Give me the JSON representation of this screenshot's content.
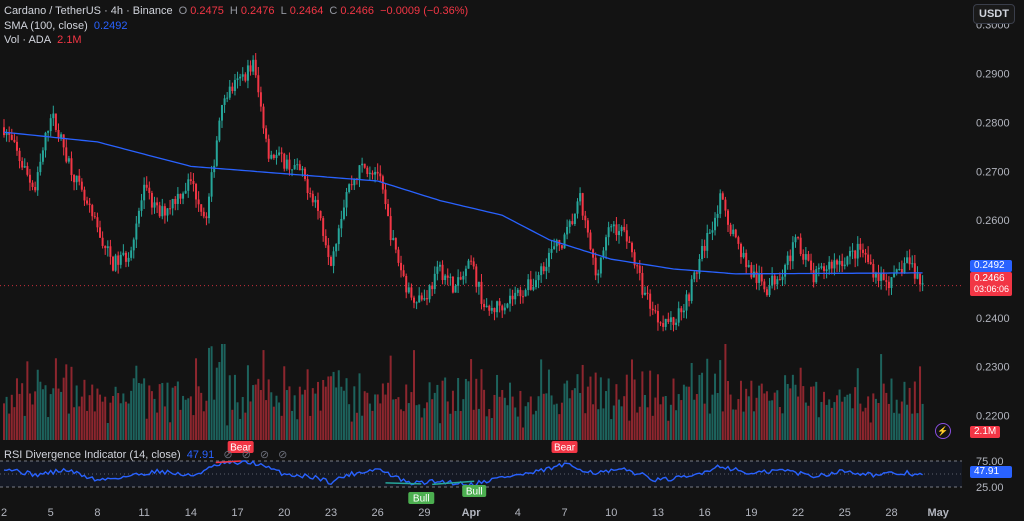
{
  "header": {
    "symbol": "Cardano / TetherUS · 4h · Binance",
    "o_key": "O",
    "o_val": "0.2475",
    "h_key": "H",
    "h_val": "0.2476",
    "l_key": "L",
    "l_val": "0.2464",
    "c_key": "C",
    "c_val": "0.2466",
    "change": "−0.0009 (−0.36%)"
  },
  "sma_legend": {
    "label": "SMA (100, close)",
    "value": "0.2492"
  },
  "vol_legend": {
    "label": "Vol · ADA",
    "value": "2.1M"
  },
  "rsi_legend": {
    "label": "RSI Divergence Indicator (14, close)",
    "value": "47.91",
    "icons": "⊘ ⊘ ⊘ ⊘"
  },
  "currency_button": "USDT",
  "price_axis_labels": [
    "0.3000",
    "0.2900",
    "0.2800",
    "0.2700",
    "0.2600",
    "0.2400",
    "0.2300",
    "0.2200"
  ],
  "sma_badge": "0.2492",
  "price_badge": {
    "price": "0.2466",
    "countdown": "03:06:06"
  },
  "volume_badge": "2.1M",
  "rsi_axis_labels": [
    "75.00",
    "25.00"
  ],
  "rsi_badge": "47.91",
  "date_labels": [
    "2",
    "5",
    "8",
    "11",
    "14",
    "17",
    "20",
    "23",
    "26",
    "29",
    "Apr",
    "4",
    "7",
    "10",
    "13",
    "16",
    "19",
    "22",
    "25",
    "28",
    "May"
  ],
  "signals": [
    {
      "label": "Bear",
      "color": "#f23645"
    },
    {
      "label": "Bear",
      "color": "#f23645"
    },
    {
      "label": "Bull",
      "color": "#4caf50"
    },
    {
      "label": "Bull",
      "color": "#4caf50"
    }
  ],
  "colors": {
    "up": "#26a69a",
    "down": "#f23645",
    "sma": "#2962ff",
    "rsi": "#2962ff",
    "background": "#131313"
  },
  "chart_data": {
    "type": "candlestick",
    "interval": "4h",
    "price_range": [
      0.215,
      0.303
    ],
    "price_waypoints": [
      [
        "Mar 2",
        0.279
      ],
      [
        "Mar 4",
        0.266
      ],
      [
        "Mar 5",
        0.282
      ],
      [
        "Mar 7",
        0.265
      ],
      [
        "Mar 9",
        0.251
      ],
      [
        "Mar 10",
        0.253
      ],
      [
        "Mar 11",
        0.266
      ],
      [
        "Mar 12",
        0.261
      ],
      [
        "Mar 14",
        0.268
      ],
      [
        "Mar 15",
        0.26
      ],
      [
        "Mar 16",
        0.285
      ],
      [
        "Mar 17",
        0.288
      ],
      [
        "Mar 18",
        0.292
      ],
      [
        "Mar 19",
        0.274
      ],
      [
        "Mar 21",
        0.27
      ],
      [
        "Mar 22",
        0.264
      ],
      [
        "Mar 23",
        0.252
      ],
      [
        "Mar 24",
        0.266
      ],
      [
        "Mar 25",
        0.271
      ],
      [
        "Mar 26",
        0.27
      ],
      [
        "Mar 27",
        0.255
      ],
      [
        "Mar 28",
        0.245
      ],
      [
        "Mar 29",
        0.244
      ],
      [
        "Mar 30",
        0.25
      ],
      [
        "Mar 31",
        0.246
      ],
      [
        "Apr 1",
        0.251
      ],
      [
        "Apr 2",
        0.241
      ],
      [
        "Apr 4",
        0.245
      ],
      [
        "Apr 5",
        0.247
      ],
      [
        "Apr 6",
        0.253
      ],
      [
        "Apr 7",
        0.256
      ],
      [
        "Apr 8",
        0.264
      ],
      [
        "Apr 9",
        0.249
      ],
      [
        "Apr 10",
        0.259
      ],
      [
        "Apr 11",
        0.257
      ],
      [
        "Apr 12",
        0.246
      ],
      [
        "Apr 13",
        0.24
      ],
      [
        "Apr 14",
        0.239
      ],
      [
        "Apr 15",
        0.245
      ],
      [
        "Apr 16",
        0.255
      ],
      [
        "Apr 17",
        0.264
      ],
      [
        "Apr 18",
        0.256
      ],
      [
        "Apr 19",
        0.249
      ],
      [
        "Apr 20",
        0.246
      ],
      [
        "Apr 21",
        0.25
      ],
      [
        "Apr 22",
        0.256
      ],
      [
        "Apr 23",
        0.248
      ],
      [
        "Apr 24",
        0.251
      ],
      [
        "Apr 25",
        0.252
      ],
      [
        "Apr 26",
        0.254
      ],
      [
        "Apr 27",
        0.249
      ],
      [
        "Apr 28",
        0.247
      ],
      [
        "Apr 29",
        0.252
      ],
      [
        "Apr 30",
        0.2466
      ]
    ],
    "sma_100_waypoints": [
      [
        "Mar 2",
        0.278
      ],
      [
        "Mar 8",
        0.276
      ],
      [
        "Mar 14",
        0.271
      ],
      [
        "Mar 18",
        0.27
      ],
      [
        "Mar 22",
        0.269
      ],
      [
        "Mar 26",
        0.268
      ],
      [
        "Mar 30",
        0.264
      ],
      [
        "Apr 3",
        0.261
      ],
      [
        "Apr 6",
        0.256
      ],
      [
        "Apr 10",
        0.252
      ],
      [
        "Apr 14",
        0.25
      ],
      [
        "Apr 18",
        0.249
      ],
      [
        "Apr 30",
        0.2492
      ]
    ],
    "volume_range": [
      0,
      12
    ],
    "rsi_waypoints": [
      [
        "Mar 2",
        62
      ],
      [
        "Mar 4",
        48
      ],
      [
        "Mar 6",
        58
      ],
      [
        "Mar 8",
        38
      ],
      [
        "Mar 10",
        46
      ],
      [
        "Mar 12",
        56
      ],
      [
        "Mar 14",
        46
      ],
      [
        "Mar 16",
        70
      ],
      [
        "Mar 18",
        72
      ],
      [
        "Mar 20",
        50
      ],
      [
        "Mar 22",
        44
      ],
      [
        "Mar 23",
        34
      ],
      [
        "Mar 24",
        48
      ],
      [
        "Mar 26",
        60
      ],
      [
        "Mar 28",
        32
      ],
      [
        "Mar 30",
        36
      ],
      [
        "Apr 1",
        30
      ],
      [
        "Apr 3",
        44
      ],
      [
        "Apr 5",
        52
      ],
      [
        "Apr 7",
        68
      ],
      [
        "Apr 9",
        52
      ],
      [
        "Apr 11",
        58
      ],
      [
        "Apr 13",
        38
      ],
      [
        "Apr 15",
        44
      ],
      [
        "Apr 17",
        66
      ],
      [
        "Apr 19",
        50
      ],
      [
        "Apr 21",
        58
      ],
      [
        "Apr 23",
        46
      ],
      [
        "Apr 25",
        56
      ],
      [
        "Apr 27",
        48
      ],
      [
        "Apr 29",
        52
      ],
      [
        "Apr 30",
        47.91
      ]
    ],
    "rsi_range": [
      0,
      100
    ],
    "rsi_levels": [
      75,
      25
    ]
  }
}
